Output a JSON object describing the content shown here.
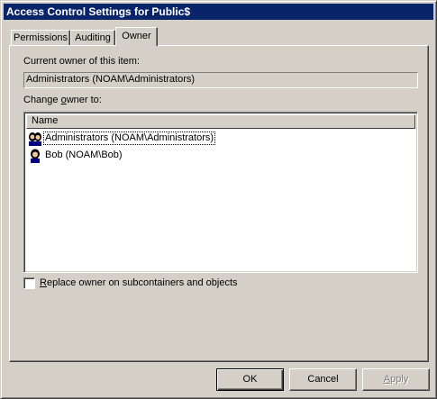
{
  "window": {
    "title": "Access Control Settings for Public$"
  },
  "tabs": [
    {
      "label": "Permissions",
      "active": false
    },
    {
      "label": "Auditing",
      "active": false
    },
    {
      "label": "Owner",
      "active": true
    }
  ],
  "owner_tab": {
    "current_owner_label": "Current owner of this item:",
    "current_owner_value": "Administrators (NOAM\\Administrators)",
    "change_owner_label_pre": "Change ",
    "change_owner_label_accel": "o",
    "change_owner_label_post": "wner to:",
    "list": {
      "column_header": "Name",
      "items": [
        {
          "label": "Administrators (NOAM\\Administrators)",
          "icon": "user-group-icon",
          "focused": true
        },
        {
          "label": "Bob (NOAM\\Bob)",
          "icon": "user-icon",
          "focused": false
        }
      ]
    },
    "replace_checkbox": {
      "label_accel": "R",
      "label_rest": "eplace owner on subcontainers and objects",
      "checked": false
    }
  },
  "buttons": {
    "ok": "OK",
    "cancel": "Cancel",
    "apply_accel": "A",
    "apply_rest": "pply",
    "apply_enabled": false
  },
  "colors": {
    "titlebar": "#0a246a",
    "face": "#d4d0c8",
    "list_bg": "#ffffff"
  }
}
